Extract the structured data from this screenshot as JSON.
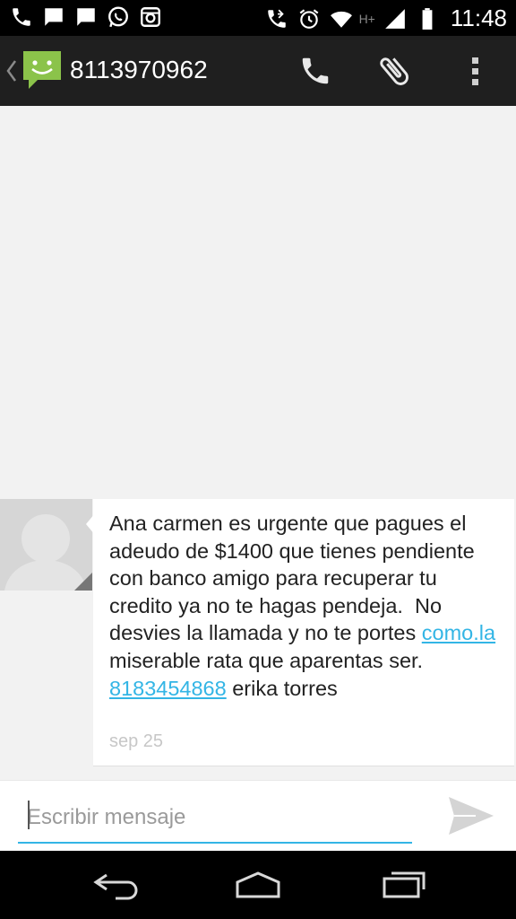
{
  "status_bar": {
    "time": "11:48",
    "network_label": "H+",
    "left_icons": [
      "phone-missed-icon",
      "message-icon",
      "message-icon",
      "whatsapp-icon",
      "instagram-icon"
    ],
    "right_icons": [
      "call-forward-icon",
      "alarm-icon",
      "wifi-icon",
      "signal-icon",
      "battery-icon"
    ]
  },
  "action_bar": {
    "title": "8113970962",
    "actions": [
      "call-icon",
      "attach-icon",
      "overflow-menu-icon"
    ]
  },
  "message": {
    "text_part1": "Ana carmen es urgente que pagues el adeudo de $1400 que tienes pendiente con banco amigo para recuperar tu credito ya no te hagas pendeja.  No desvies la llamada y no te portes ",
    "link1": "como.la",
    "text_part2": " miserable rata que aparentas ser. ",
    "link2": "8183454868",
    "text_part3": " erika torres",
    "date": "sep 25"
  },
  "compose": {
    "placeholder": "Escribir mensaje"
  },
  "nav": {
    "buttons": [
      "back-icon",
      "home-icon",
      "recents-icon"
    ]
  },
  "colors": {
    "accent": "#33b5e5",
    "action_bar": "#1f1f1f",
    "background": "#f2f2f2",
    "app_icon_green": "#8bc34a"
  }
}
